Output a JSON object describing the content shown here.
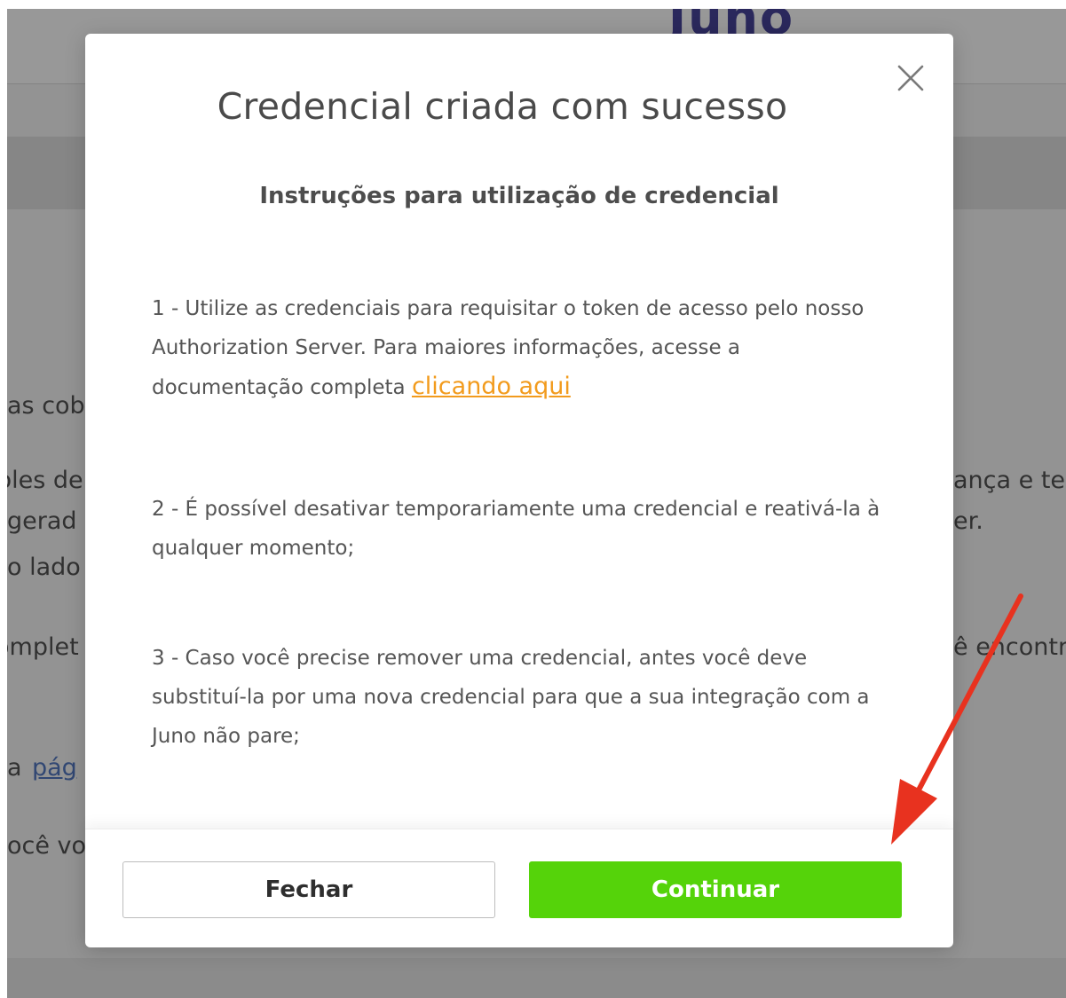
{
  "background": {
    "logo": "Juno",
    "fragments": [
      {
        "id": "frag-1",
        "text": "as cob"
      },
      {
        "id": "frag-2",
        "text": "bles de"
      },
      {
        "id": "frag-3",
        "text": "gerad"
      },
      {
        "id": "frag-4",
        "text": "o lado"
      },
      {
        "id": "frag-5",
        "text": "omplet"
      },
      {
        "id": "frag-6",
        "text": "a "
      },
      {
        "id": "frag-7",
        "text": "pág"
      },
      {
        "id": "frag-8",
        "text": "ocê vo"
      },
      {
        "id": "frag-9",
        "text": "ança e te"
      },
      {
        "id": "frag-10",
        "text": "er."
      },
      {
        "id": "frag-11",
        "text": "ê encontr"
      }
    ]
  },
  "modal": {
    "title": "Credencial criada com sucesso",
    "close_icon": "close-icon",
    "subheading": "Instruções para utilização de credencial",
    "paragraphs": {
      "p1_text": "1 - Utilize as credenciais para requisitar o token de acesso pelo nosso Authorization Server. Para maiores informações, acesse a documentação completa ",
      "p1_link": "clicando aqui",
      "p2_text": "2 - É possível desativar temporariamente uma credencial e reativá-la à qualquer momento;",
      "p3_text": "3 - Caso você precise remover uma credencial, antes você deve substituí-la por uma nova credencial para que a sua integração com a Juno não pare;"
    },
    "buttons": {
      "close_label": "Fechar",
      "continue_label": "Continuar"
    }
  },
  "colors": {
    "link": "#f29b1d",
    "continue_button": "#55d30a",
    "annotation_arrow": "#e8321f",
    "logo": "#2c2a8c"
  }
}
